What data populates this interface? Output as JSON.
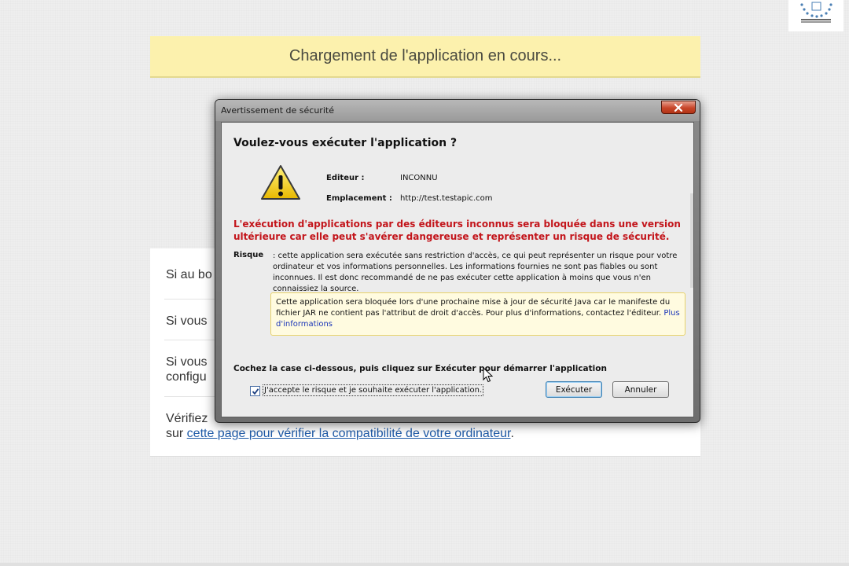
{
  "banner": {
    "text": "Chargement de l'application en cours..."
  },
  "card": {
    "rows": [
      "Si au bo",
      "Si vous",
      "Si vous",
      "configu",
      "Vérifiez"
    ],
    "last_prefix": "sur ",
    "last_link": "cette page pour vérifier la compatibilité de votre ordinateur",
    "last_suffix": "."
  },
  "dialog": {
    "title": "Avertissement de sécurité",
    "heading": "Voulez-vous exécuter l'application ?",
    "publisher_label": "Editeur :",
    "publisher_value": "INCONNU",
    "location_label": "Emplacement :",
    "location_value": "http://test.testapic.com",
    "red_warning": "L'exécution d'applications par des éditeurs inconnus sera bloquée dans une version ultérieure car elle peut s'avérer dangereuse et représenter un risque de sécurité.",
    "risk_label": "Risque",
    "risk_text": ": cette application sera exécutée sans restriction d'accès, ce qui peut représenter un risque pour votre ordinateur et vos informations personnelles. Les informations fournies ne sont pas fiables ou sont inconnues. Il est donc recommandé de ne pas exécuter cette application à moins que vous n'en connaissiez la source.",
    "info_text": "Cette application sera bloquée lors d'une prochaine mise à jour de sécurité Java car le manifeste du fichier JAR ne contient pas l'attribut de droit d'accès. Pour plus d'informations, contactez l'éditeur. ",
    "info_link": "Plus d'informations",
    "instruction": "Cochez la case ci-dessous, puis cliquez sur Exécuter pour démarrer l'application",
    "checkbox_label": "J'accepte le risque et je souhaite exécuter l'application.",
    "checkbox_checked": true,
    "run_button": "Exécuter",
    "cancel_button": "Annuler"
  },
  "colors": {
    "banner_bg": "#fcf1ad",
    "warning_red": "#c3151b",
    "link_blue": "#1f5ba8",
    "close_red": "#c8462a"
  },
  "icons": [
    "logo-icon",
    "warning-icon",
    "close-icon",
    "check-icon",
    "cursor-icon"
  ]
}
